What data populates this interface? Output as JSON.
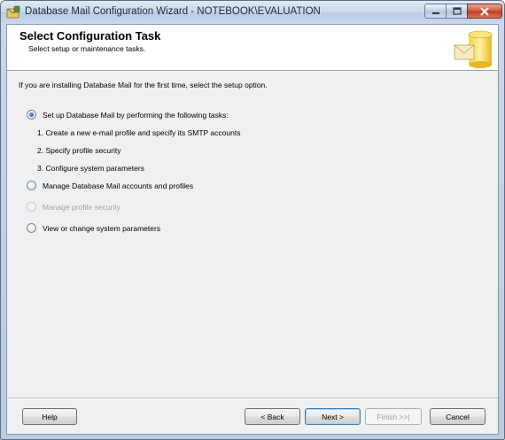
{
  "window": {
    "title": "Database Mail Configuration Wizard - NOTEBOOK\\EVALUATION"
  },
  "header": {
    "title": "Select Configuration Task",
    "subtitle": "Select setup or maintenance tasks."
  },
  "intro_text": "If you are installing Database Mail for the first time, select the setup option.",
  "options": [
    {
      "label": "Set up Database Mail by performing the following tasks:",
      "checked": true,
      "enabled": true
    },
    {
      "label": "Manage Database Mail accounts and profiles",
      "checked": false,
      "enabled": true
    },
    {
      "label": "Manage profile security",
      "checked": false,
      "enabled": false
    },
    {
      "label": "View or change system parameters",
      "checked": false,
      "enabled": true
    }
  ],
  "setup_tasks": [
    "1. Create a new e-mail profile and specify its SMTP accounts",
    "2. Specify profile security",
    "3. Configure system parameters"
  ],
  "buttons": {
    "help": "Help",
    "back": "< Back",
    "next": "Next >",
    "finish": "Finish >>|",
    "cancel": "Cancel"
  },
  "icons": {
    "app": "database-mail-app-icon",
    "header": "database-envelope-icon",
    "minimize": "minimize-icon",
    "maximize": "maximize-icon",
    "close": "close-icon"
  }
}
